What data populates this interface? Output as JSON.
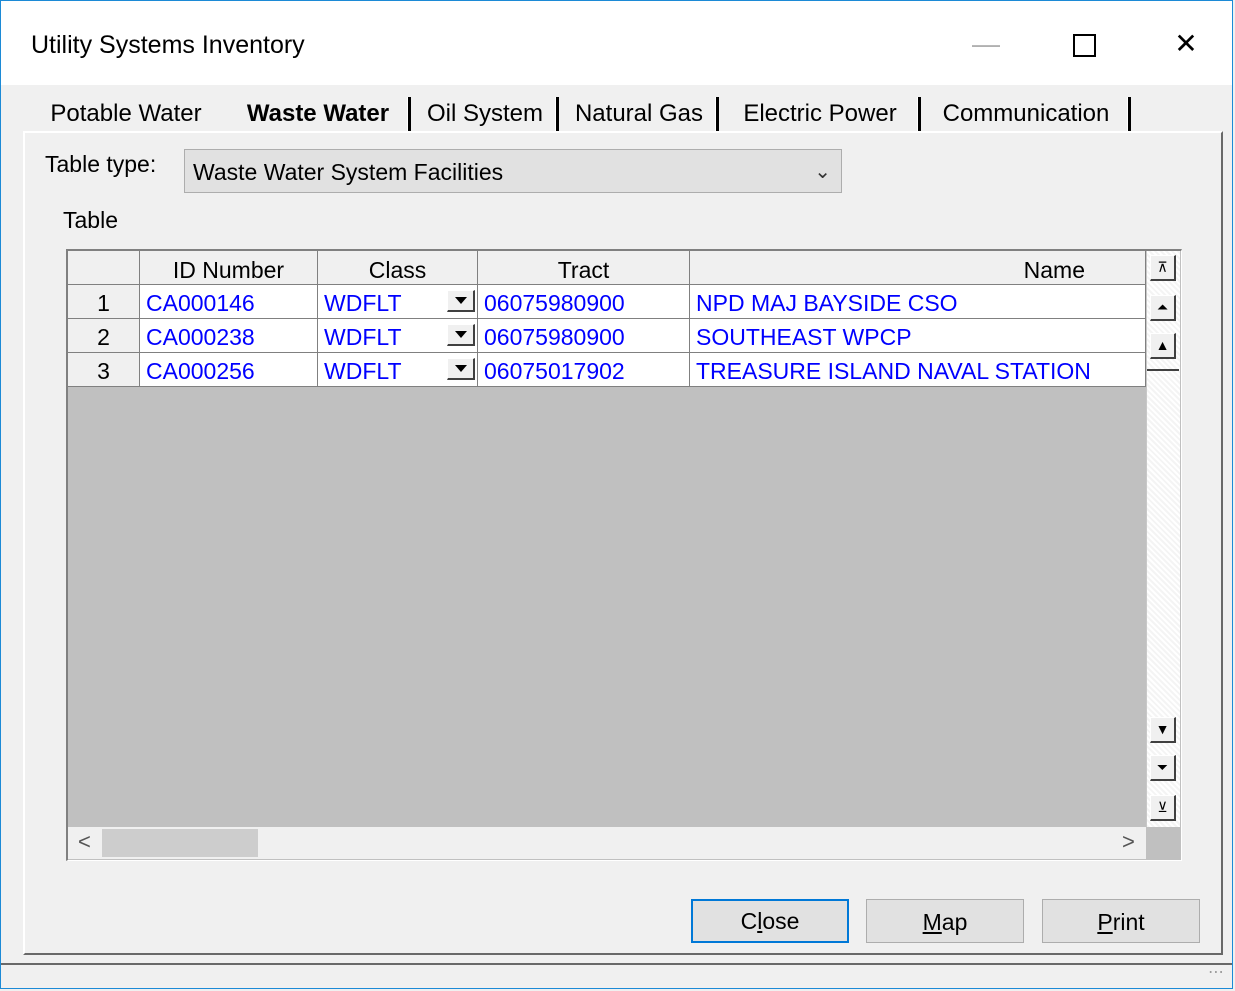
{
  "window": {
    "title": "Utility Systems Inventory",
    "controls": {
      "minimize": "—",
      "close": "✕"
    }
  },
  "tabs": [
    {
      "label": "Potable Water",
      "active": false
    },
    {
      "label": "Waste Water",
      "active": true
    },
    {
      "label": "Oil System",
      "active": false
    },
    {
      "label": "Natural Gas",
      "active": false
    },
    {
      "label": "Electric Power",
      "active": false
    },
    {
      "label": "Communication",
      "active": false
    }
  ],
  "table_type": {
    "label": "Table type:",
    "selected": "Waste Water System Facilities"
  },
  "table": {
    "label": "Table",
    "columns": [
      "",
      "ID Number",
      "Class",
      "Tract",
      "Name"
    ],
    "rows": [
      {
        "num": "1",
        "id": "CA000146",
        "class": "WDFLT",
        "tract": "06075980900",
        "name": "NPD MAJ BAYSIDE CSO"
      },
      {
        "num": "2",
        "id": "CA000238",
        "class": "WDFLT",
        "tract": "06075980900",
        "name": "SOUTHEAST WPCP"
      },
      {
        "num": "3",
        "id": "CA000256",
        "class": "WDFLT",
        "tract": "06075017902",
        "name": "TREASURE ISLAND NAVAL STATION"
      }
    ],
    "scroll": {
      "left": "<",
      "right": ">"
    }
  },
  "buttons": {
    "close": {
      "pre": "C",
      "accel": "l",
      "post": "ose"
    },
    "map": {
      "pre": "",
      "accel": "M",
      "post": "ap"
    },
    "print": {
      "pre": "",
      "accel": "P",
      "post": "rint"
    }
  },
  "colors": {
    "cell_text": "#0000ff",
    "grid_bg": "#c0c0c0",
    "default_button_border": "#0078d7"
  }
}
